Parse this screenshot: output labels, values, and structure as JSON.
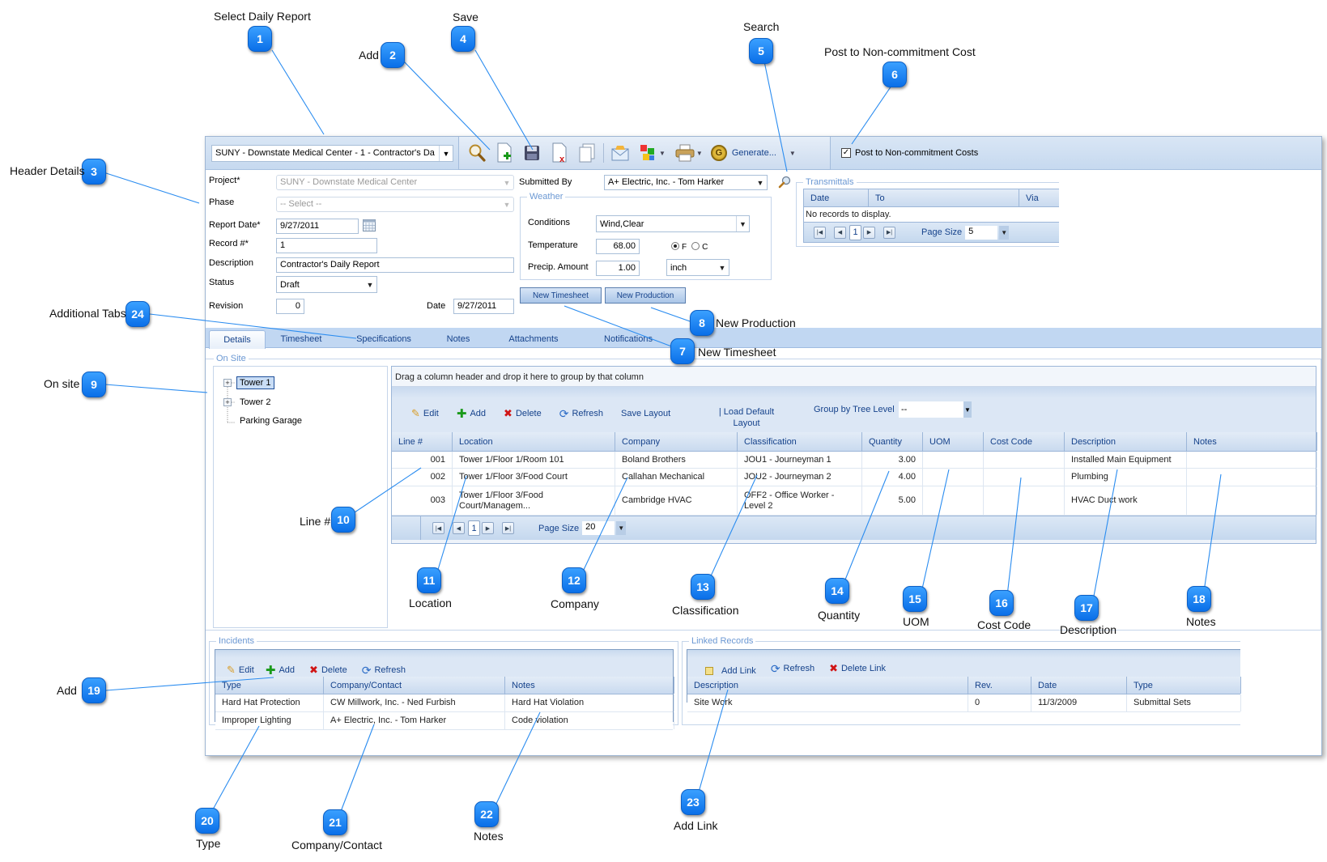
{
  "callouts": [
    {
      "num": "1",
      "label": "Select Daily Report"
    },
    {
      "num": "2",
      "label": "Add"
    },
    {
      "num": "3",
      "label": "Header Details"
    },
    {
      "num": "4",
      "label": "Save"
    },
    {
      "num": "5",
      "label": "Search"
    },
    {
      "num": "6",
      "label": "Post to Non-commitment Cost"
    },
    {
      "num": "7",
      "label": "New Timesheet"
    },
    {
      "num": "8",
      "label": "New Production"
    },
    {
      "num": "9",
      "label": "On site"
    },
    {
      "num": "10",
      "label": "Line #"
    },
    {
      "num": "11",
      "label": "Location"
    },
    {
      "num": "12",
      "label": "Company"
    },
    {
      "num": "13",
      "label": "Classification"
    },
    {
      "num": "14",
      "label": "Quantity"
    },
    {
      "num": "15",
      "label": "UOM"
    },
    {
      "num": "16",
      "label": "Cost Code"
    },
    {
      "num": "17",
      "label": "Description"
    },
    {
      "num": "18",
      "label": "Notes"
    },
    {
      "num": "19",
      "label": "Add"
    },
    {
      "num": "20",
      "label": "Type"
    },
    {
      "num": "21",
      "label": "Company/Contact"
    },
    {
      "num": "22",
      "label": "Notes"
    },
    {
      "num": "23",
      "label": "Add Link"
    },
    {
      "num": "24",
      "label": "Additional Tabs"
    }
  ],
  "topbar": {
    "report_select": "SUNY - Downstate Medical Center - 1 - Contractor's Da",
    "toolbar_icons": [
      "search-icon",
      "add-document-icon",
      "save-icon",
      "delete-document-icon",
      "copy-icon",
      "email-icon",
      "workflow-icon",
      "print-icon"
    ],
    "generate_label": "Generate...",
    "post_checkbox_label": "Post to Non-commitment Costs",
    "post_checked": true
  },
  "header": {
    "project_label": "Project*",
    "project_value": "SUNY - Downstate Medical Center",
    "phase_label": "Phase",
    "phase_value": "-- Select --",
    "report_date_label": "Report Date*",
    "report_date_value": "9/27/2011",
    "record_label": "Record #*",
    "record_value": "1",
    "description_label": "Description",
    "description_value": "Contractor's Daily Report",
    "status_label": "Status",
    "status_value": "Draft",
    "revision_label": "Revision",
    "revision_value": "0",
    "date_label": "Date",
    "date_value": "9/27/2011",
    "submitted_by_label": "Submitted By",
    "submitted_by_value": "A+ Electric, Inc. - Tom Harker"
  },
  "weather": {
    "legend": "Weather",
    "conditions_label": "Conditions",
    "conditions_value": "Wind,Clear",
    "temperature_label": "Temperature",
    "temperature_value": "68.00",
    "unit_f": "F",
    "unit_c": "C",
    "selected_unit": "F",
    "precip_label": "Precip. Amount",
    "precip_value": "1.00",
    "precip_unit": "inch"
  },
  "buttons": {
    "new_timesheet": "New Timesheet",
    "new_production": "New Production"
  },
  "transmittals": {
    "legend": "Transmittals",
    "columns": [
      "Date",
      "To",
      "Via"
    ],
    "empty_text": "No records to display.",
    "page": "1",
    "page_size_label": "Page Size",
    "page_size": "5"
  },
  "tabs": [
    {
      "label": "Details",
      "active": true
    },
    {
      "label": "Timesheet",
      "active": false
    },
    {
      "label": "Specifications",
      "active": false
    },
    {
      "label": "Notes",
      "active": false
    },
    {
      "label": "Attachments",
      "active": false
    },
    {
      "label": "Notifications",
      "active": false
    }
  ],
  "onsite": {
    "legend": "On Site",
    "tree": [
      {
        "label": "Tower 1",
        "expandable": true,
        "selected": true
      },
      {
        "label": "Tower 2",
        "expandable": true,
        "selected": false
      },
      {
        "label": "Parking Garage",
        "expandable": false,
        "selected": false
      }
    ]
  },
  "main_grid": {
    "group_hint": "Drag a column header and drop it here to group by that column",
    "toolbar": {
      "edit": "Edit",
      "add": "Add",
      "delete": "Delete",
      "refresh": "Refresh",
      "save_layout": "Save Layout",
      "load_default_layout": "| Load Default Layout",
      "group_by_label": "Group by Tree Level",
      "group_by_value": "--"
    },
    "columns": [
      "Line #",
      "Location",
      "Company",
      "Classification",
      "Quantity",
      "UOM",
      "Cost Code",
      "Description",
      "Notes"
    ],
    "rows": [
      [
        "001",
        "Tower 1/Floor 1/Room 101",
        "Boland Brothers",
        "JOU1 - Journeyman 1",
        "3.00",
        "",
        "",
        "Installed Main Equipment",
        ""
      ],
      [
        "002",
        "Tower 1/Floor 3/Food Court",
        "Callahan Mechanical",
        "JOU2 - Journeyman 2",
        "4.00",
        "",
        "",
        "Plumbing",
        ""
      ],
      [
        "003",
        "Tower 1/Floor 3/Food Court/Managem...",
        "Cambridge HVAC",
        "OFF2 - Office Worker - Level 2",
        "5.00",
        "",
        "",
        "HVAC Duct work",
        ""
      ]
    ],
    "page": "1",
    "page_size_label": "Page Size",
    "page_size": "20"
  },
  "incidents": {
    "legend": "Incidents",
    "toolbar": {
      "edit": "Edit",
      "add": "Add",
      "delete": "Delete",
      "refresh": "Refresh"
    },
    "columns": [
      "Type",
      "Company/Contact",
      "Notes"
    ],
    "rows": [
      [
        "Hard Hat Protection",
        "CW Millwork, Inc. - Ned Furbish",
        "Hard Hat Violation"
      ],
      [
        "Improper Lighting",
        "A+ Electric, Inc. - Tom Harker",
        "Code violation"
      ]
    ]
  },
  "linked_records": {
    "legend": "Linked Records",
    "toolbar": {
      "add_link": "Add Link",
      "refresh": "Refresh",
      "delete_link": "Delete Link"
    },
    "columns": [
      "Description",
      "Rev.",
      "Date",
      "Type"
    ],
    "rows": [
      [
        "Site Work",
        "0",
        "11/3/2009",
        "Submittal Sets"
      ]
    ]
  },
  "colors": {
    "accent": "#15428b",
    "callout": "#0a6fe8",
    "header_bar": "#c6d9ef",
    "tab_strip": "#c1d7f2"
  }
}
